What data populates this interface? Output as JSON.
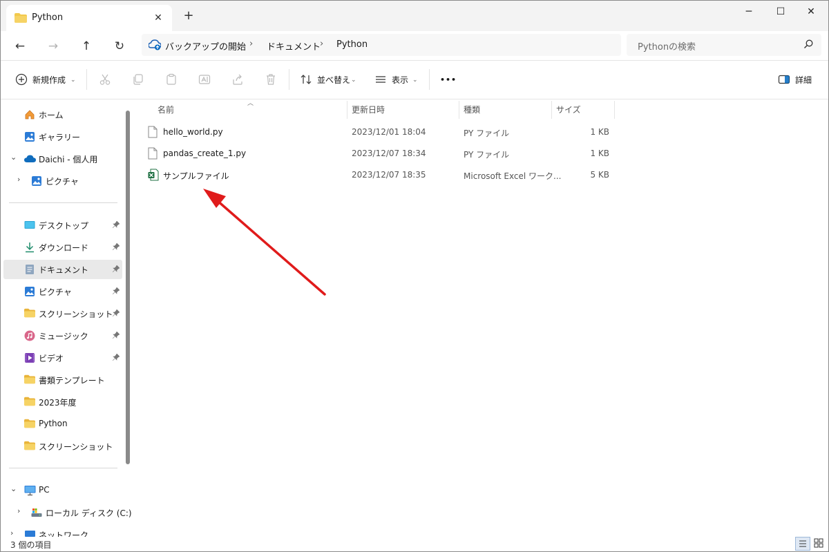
{
  "window": {
    "tab_title": "Python",
    "tab_close": "✕",
    "new_tab": "+",
    "minimize": "─",
    "maximize": "☐",
    "close": "✕"
  },
  "nav": {
    "back": "←",
    "forward": "→",
    "up": "↑",
    "refresh": "↻",
    "breadcrumbs": [
      "バックアップの開始",
      "ドキュメント",
      "Python"
    ],
    "separator": "›",
    "search_placeholder": "Pythonの検索"
  },
  "toolbar": {
    "new_label": "新規作成",
    "sort_label": "並べ替え",
    "view_label": "表示",
    "more_label": "•••",
    "details_label": "詳細"
  },
  "sidebar": {
    "home": "ホーム",
    "gallery": "ギャラリー",
    "onedrive": "Daichi - 個人用",
    "onedrive_pictures": "ピクチャ",
    "quick_access": [
      {
        "label": "デスクトップ",
        "icon": "desktop-icon"
      },
      {
        "label": "ダウンロード",
        "icon": "download-icon"
      },
      {
        "label": "ドキュメント",
        "icon": "documents-icon",
        "selected": true
      },
      {
        "label": "ピクチャ",
        "icon": "pictures-icon"
      },
      {
        "label": "スクリーンショット",
        "icon": "folder-icon"
      },
      {
        "label": "ミュージック",
        "icon": "music-icon"
      },
      {
        "label": "ビデオ",
        "icon": "video-icon"
      }
    ],
    "folders": [
      "書類テンプレート",
      "2023年度",
      "Python",
      "スクリーンショット"
    ],
    "pc": "PC",
    "local_disk": "ローカル ディスク (C:)",
    "network": "ネットワーク"
  },
  "columns": {
    "name": "名前",
    "modified": "更新日時",
    "type": "種類",
    "size": "サイズ"
  },
  "files": [
    {
      "name": "hello_world.py",
      "modified": "2023/12/01 18:04",
      "type": "PY ファイル",
      "size": "1 KB",
      "icon": "text-file-icon"
    },
    {
      "name": "pandas_create_1.py",
      "modified": "2023/12/07 18:34",
      "type": "PY ファイル",
      "size": "1 KB",
      "icon": "text-file-icon"
    },
    {
      "name": "サンプルファイル",
      "modified": "2023/12/07 18:35",
      "type": "Microsoft Excel ワーク...",
      "size": "5 KB",
      "icon": "excel-file-icon"
    }
  ],
  "status": {
    "item_count": "3 個の項目"
  },
  "colors": {
    "accent": "#0067c0",
    "annotation_arrow": "#e01b1b",
    "folder": "#f2c94c",
    "excel": "#1d6f42"
  }
}
